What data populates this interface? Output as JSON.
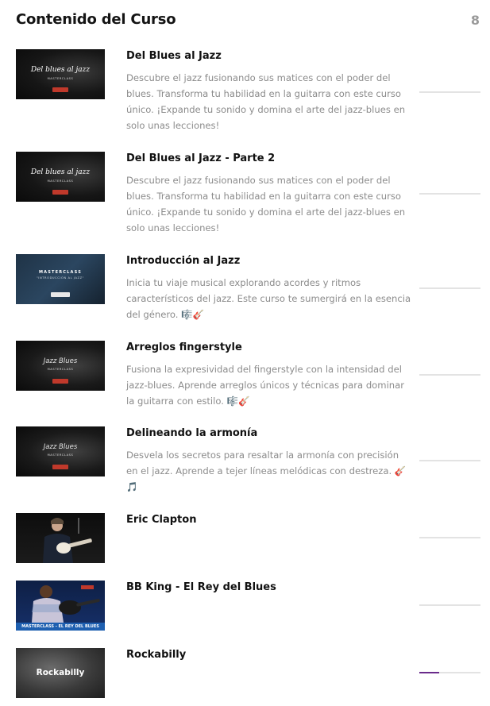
{
  "header": {
    "title": "Contenido del Curso",
    "count": "8"
  },
  "colors": {
    "progress_fill": "#6a2b8b",
    "progress_track": "#e3e3e3",
    "description_text": "#8c8c8c",
    "bb_king_banner": "#1e5fb0"
  },
  "items": [
    {
      "title": "Del Blues al Jazz",
      "description": "Descubre el jazz fusionando sus matices con el poder del blues. Transforma tu habilidad en la guitarra con este curso único. ¡Expande tu sonido y domina el arte del jazz-blues en solo unas lecciones!",
      "thumb": {
        "main": "Del blues al jazz",
        "sub": "MASTERCLASS"
      },
      "progress": 0
    },
    {
      "title": "Del Blues al Jazz - Parte 2",
      "description": "Descubre el jazz fusionando sus matices con el poder del blues. Transforma tu habilidad en la guitarra con este curso único. ¡Expande tu sonido y domina el arte del jazz-blues en solo unas lecciones!",
      "thumb": {
        "main": "Del blues al jazz",
        "sub": "MASTERCLASS"
      },
      "progress": 0
    },
    {
      "title": "Introducción al Jazz",
      "description": "Inicia tu viaje musical explorando acordes y ritmos característicos del jazz. Este curso te sumergirá en la esencia del género. 🎼🎸",
      "thumb": {
        "main": "MASTERCLASS",
        "sub": "\"INTRODUCCIÓN AL JAZZ\""
      },
      "progress": 0
    },
    {
      "title": "Arreglos fingerstyle",
      "description": "Fusiona la expresividad del fingerstyle con la intensidad del jazz-blues. Aprende arreglos únicos y técnicas para dominar la guitarra con estilo. 🎼🎸",
      "thumb": {
        "main": "Jazz Blues",
        "sub": "MASTERCLASS"
      },
      "progress": 0
    },
    {
      "title": "Delineando la armonía",
      "description": "Desvela los secretos para resaltar la armonía con precisión en el jazz. Aprende a tejer líneas melódicas con destreza. 🎸 🎵",
      "thumb": {
        "main": "Jazz Blues",
        "sub": "MASTERCLASS"
      },
      "progress": 0
    },
    {
      "title": "Eric Clapton",
      "description": "",
      "progress": 0
    },
    {
      "title": "BB King - El Rey del Blues",
      "description": "",
      "thumb": {
        "banner": "MASTERCLASS - EL REY DEL BLUES"
      },
      "progress": 0
    },
    {
      "title": "Rockabilly",
      "description": "",
      "thumb": {
        "main": "Rockabilly"
      },
      "progress": 0.32
    }
  ]
}
